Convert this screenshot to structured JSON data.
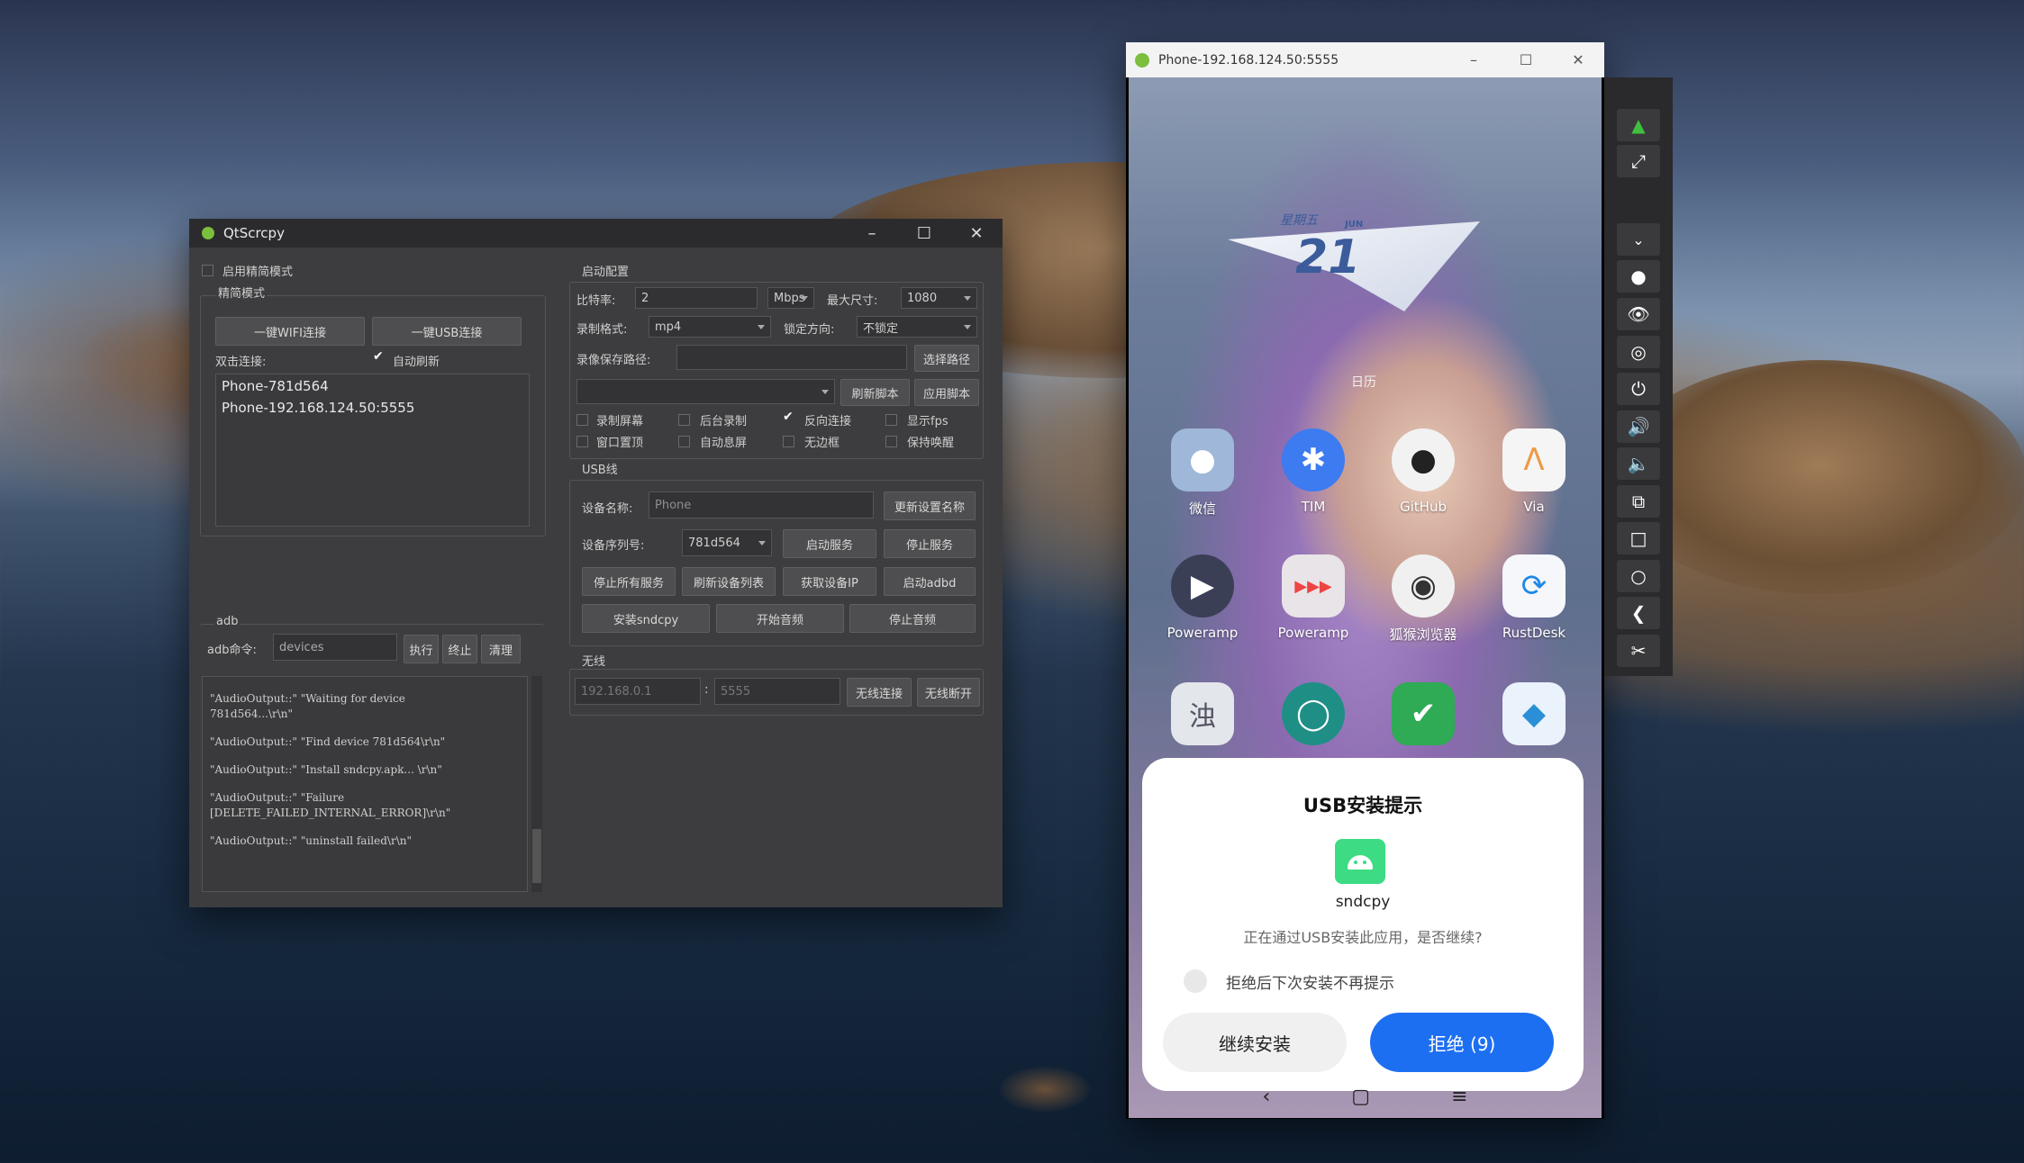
{
  "qt": {
    "title": "QtScrcpy",
    "simple_mode_checkbox": "启用精简模式",
    "simple_mode_group": "精简模式",
    "wifi_connect": "一键WIFI连接",
    "usb_connect": "一键USB连接",
    "double_click_label": "双击连接:",
    "auto_refresh": "自动刷新",
    "device_list": [
      "Phone-781d564",
      "Phone-192.168.124.50:5555"
    ],
    "adb_group": "adb",
    "adb_cmd_label": "adb命令:",
    "adb_cmd_value": "devices",
    "exec": "执行",
    "stop": "终止",
    "clear": "清理",
    "log": [
      "\"AudioOutput::\" \"Waiting for device 781d564...\\r\\n\"",
      "\"AudioOutput::\" \"Find device 781d564\\r\\n\"",
      "\"AudioOutput::\" \"Install sndcpy.apk... \\r\\n\"",
      "\"AudioOutput::\" \"Failure [DELETE_FAILED_INTERNAL_ERROR]\\r\\n\"",
      "\"AudioOutput::\" \"uninstall failed\\r\\n\""
    ],
    "start_config": "启动配置",
    "bitrate_label": "比特率:",
    "bitrate_value": "2",
    "bitrate_unit": "Mbps",
    "max_size_label": "最大尺寸:",
    "max_size_value": "1080",
    "record_format_label": "录制格式:",
    "record_format_value": "mp4",
    "lock_orientation_label": "锁定方向:",
    "lock_orientation_value": "不锁定",
    "record_path_label": "录像保存路径:",
    "select_path": "选择路径",
    "refresh_script": "刷新脚本",
    "apply_script": "应用脚本",
    "checkboxes": [
      {
        "label": "录制屏幕",
        "checked": false
      },
      {
        "label": "后台录制",
        "checked": false
      },
      {
        "label": "反向连接",
        "checked": true
      },
      {
        "label": "显示fps",
        "checked": false
      },
      {
        "label": "窗口置顶",
        "checked": false
      },
      {
        "label": "自动息屏",
        "checked": false
      },
      {
        "label": "无边框",
        "checked": false
      },
      {
        "label": "保持唤醒",
        "checked": false
      }
    ],
    "usb_group": "USB线",
    "device_name_label": "设备名称:",
    "device_name_value": "Phone",
    "update_name": "更新设置名称",
    "serial_label": "设备序列号:",
    "serial_value": "781d564",
    "start_service": "启动服务",
    "stop_service": "停止服务",
    "stop_all": "停止所有服务",
    "refresh_devices": "刷新设备列表",
    "get_ip": "获取设备IP",
    "start_adbd": "启动adbd",
    "install_sndcpy": "安装sndcpy",
    "start_audio": "开始音频",
    "stop_audio": "停止音频",
    "wireless_group": "无线",
    "ip_placeholder": "192.168.0.1",
    "port_placeholder": "5555",
    "wireless_connect": "无线连接",
    "wireless_disconnect": "无线断开"
  },
  "phone": {
    "title": "Phone-192.168.124.50:5555",
    "calendar": {
      "week": "星期五",
      "month": "JUN",
      "day": "21",
      "label": "日历"
    },
    "apps": [
      {
        "label": "微信",
        "icon": "wechat-icon",
        "color": "#9fb7d9"
      },
      {
        "label": "TIM",
        "icon": "tim-icon",
        "color": "#3d7bf0"
      },
      {
        "label": "GitHub",
        "icon": "github-icon",
        "color": "#f2f2f2"
      },
      {
        "label": "Via",
        "icon": "via-icon",
        "color": "#f5f5f5"
      },
      {
        "label": "Poweramp",
        "icon": "poweramp-icon",
        "color": "#3a3f55"
      },
      {
        "label": "Poweramp",
        "icon": "poweramp-eq-icon",
        "color": "#e9e4e8"
      },
      {
        "label": "狐猴浏览器",
        "icon": "lemur-browser-icon",
        "color": "#f0f0f0"
      },
      {
        "label": "RustDesk",
        "icon": "rustdesk-icon",
        "color": "#f5f7fb"
      }
    ],
    "dock_apps": [
      "cloud-music-icon",
      "settings-ring-icon",
      "shield-check-icon",
      "store-icon"
    ],
    "dialog": {
      "title": "USB安装提示",
      "app_name": "sndcpy",
      "message": "正在通过USB安装此应用，是否继续?",
      "radio_label": "拒绝后下次安装不再提示",
      "continue": "继续安装",
      "reject": "拒绝 (9)"
    }
  },
  "colors": {
    "accent_blue": "#1d6ff2",
    "android_green": "#3ddc84"
  }
}
